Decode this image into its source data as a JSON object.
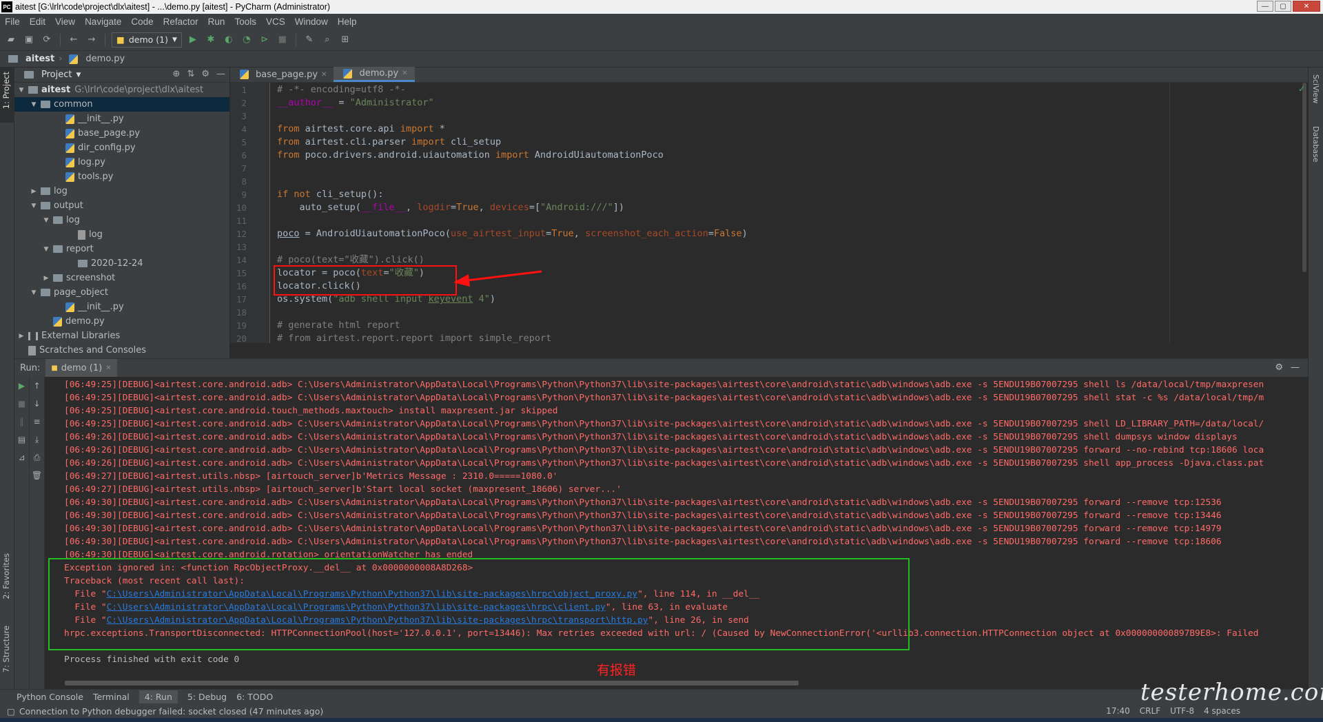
{
  "window": {
    "title": "aitest [G:\\lrlr\\code\\project\\dlx\\aitest] - ...\\demo.py [aitest] - PyCharm (Administrator)",
    "logo": "PC"
  },
  "menu": [
    "File",
    "Edit",
    "View",
    "Navigate",
    "Code",
    "Refactor",
    "Run",
    "Tools",
    "VCS",
    "Window",
    "Help"
  ],
  "toolbar": {
    "run_config": "demo (1)"
  },
  "breadcrumb": {
    "project": "aitest",
    "file": "demo.py"
  },
  "left_strip": {
    "project": "1: Project",
    "favorites": "2: Favorites",
    "structure": "7: Structure"
  },
  "right_strip": {
    "sciview": "SciView",
    "database": "Database"
  },
  "project_panel": {
    "title": "Project",
    "root_name": "aitest",
    "root_path": "G:\\lrlr\\code\\project\\dlx\\aitest",
    "items": [
      {
        "label": "common",
        "type": "folder",
        "indent": 1,
        "open": true,
        "selected": true
      },
      {
        "label": "__init__.py",
        "type": "py",
        "indent": 3
      },
      {
        "label": "base_page.py",
        "type": "py",
        "indent": 3
      },
      {
        "label": "dir_config.py",
        "type": "py",
        "indent": 3
      },
      {
        "label": "log.py",
        "type": "py",
        "indent": 3
      },
      {
        "label": "tools.py",
        "type": "py",
        "indent": 3
      },
      {
        "label": "log",
        "type": "folder",
        "indent": 1,
        "open": false
      },
      {
        "label": "output",
        "type": "folder",
        "indent": 1,
        "open": true
      },
      {
        "label": "log",
        "type": "folder",
        "indent": 2,
        "open": true
      },
      {
        "label": "log",
        "type": "file",
        "indent": 4
      },
      {
        "label": "report",
        "type": "folder",
        "indent": 2,
        "open": true
      },
      {
        "label": "2020-12-24",
        "type": "folder",
        "indent": 4
      },
      {
        "label": "screenshot",
        "type": "folder",
        "indent": 2,
        "open": false
      },
      {
        "label": "page_object",
        "type": "folder",
        "indent": 1,
        "open": true
      },
      {
        "label": "__init__.py",
        "type": "py",
        "indent": 3
      },
      {
        "label": "demo.py",
        "type": "py",
        "indent": 2
      },
      {
        "label": "External Libraries",
        "type": "lib",
        "indent": 0,
        "open": false
      },
      {
        "label": "Scratches and Consoles",
        "type": "scratch",
        "indent": 0
      }
    ]
  },
  "editor": {
    "tabs": [
      {
        "label": "base_page.py",
        "active": false
      },
      {
        "label": "demo.py",
        "active": true
      }
    ],
    "line_numbers": [
      "1",
      "2",
      "3",
      "4",
      "5",
      "6",
      "7",
      "8",
      "9",
      "10",
      "11",
      "12",
      "13",
      "14",
      "15",
      "16",
      "17",
      "18",
      "19",
      "20"
    ]
  },
  "run_panel": {
    "label": "Run:",
    "tab": "demo (1)",
    "debug_lines": [
      "[06:49:25][DEBUG]<airtest.core.android.adb> C:\\Users\\Administrator\\AppData\\Local\\Programs\\Python\\Python37\\lib\\site-packages\\airtest\\core\\android\\static\\adb\\windows\\adb.exe -s 5ENDU19B07007295 shell ls /data/local/tmp/maxpresen",
      "[06:49:25][DEBUG]<airtest.core.android.adb> C:\\Users\\Administrator\\AppData\\Local\\Programs\\Python\\Python37\\lib\\site-packages\\airtest\\core\\android\\static\\adb\\windows\\adb.exe -s 5ENDU19B07007295 shell stat -c %s /data/local/tmp/m",
      "[06:49:25][DEBUG]<airtest.core.android.touch_methods.maxtouch> install maxpresent.jar skipped",
      "[06:49:25][DEBUG]<airtest.core.android.adb> C:\\Users\\Administrator\\AppData\\Local\\Programs\\Python\\Python37\\lib\\site-packages\\airtest\\core\\android\\static\\adb\\windows\\adb.exe -s 5ENDU19B07007295 shell LD_LIBRARY_PATH=/data/local/",
      "[06:49:26][DEBUG]<airtest.core.android.adb> C:\\Users\\Administrator\\AppData\\Local\\Programs\\Python\\Python37\\lib\\site-packages\\airtest\\core\\android\\static\\adb\\windows\\adb.exe -s 5ENDU19B07007295 shell dumpsys window displays",
      "[06:49:26][DEBUG]<airtest.core.android.adb> C:\\Users\\Administrator\\AppData\\Local\\Programs\\Python\\Python37\\lib\\site-packages\\airtest\\core\\android\\static\\adb\\windows\\adb.exe -s 5ENDU19B07007295 forward --no-rebind tcp:18606 loca",
      "[06:49:26][DEBUG]<airtest.core.android.adb> C:\\Users\\Administrator\\AppData\\Local\\Programs\\Python\\Python37\\lib\\site-packages\\airtest\\core\\android\\static\\adb\\windows\\adb.exe -s 5ENDU19B07007295 shell app_process -Djava.class.pat",
      "[06:49:27][DEBUG]<airtest.utils.nbsp> [airtouch_server]b'Metrics Message : 2310.0=====1080.0'",
      "[06:49:27][DEBUG]<airtest.utils.nbsp> [airtouch_server]b'Start local socket (maxpresent_18606) server...'",
      "[06:49:30][DEBUG]<airtest.core.android.adb> C:\\Users\\Administrator\\AppData\\Local\\Programs\\Python\\Python37\\lib\\site-packages\\airtest\\core\\android\\static\\adb\\windows\\adb.exe -s 5ENDU19B07007295 forward --remove tcp:12536",
      "[06:49:30][DEBUG]<airtest.core.android.adb> C:\\Users\\Administrator\\AppData\\Local\\Programs\\Python\\Python37\\lib\\site-packages\\airtest\\core\\android\\static\\adb\\windows\\adb.exe -s 5ENDU19B07007295 forward --remove tcp:13446",
      "[06:49:30][DEBUG]<airtest.core.android.adb> C:\\Users\\Administrator\\AppData\\Local\\Programs\\Python\\Python37\\lib\\site-packages\\airtest\\core\\android\\static\\adb\\windows\\adb.exe -s 5ENDU19B07007295 forward --remove tcp:14979",
      "[06:49:30][DEBUG]<airtest.core.android.adb> C:\\Users\\Administrator\\AppData\\Local\\Programs\\Python\\Python37\\lib\\site-packages\\airtest\\core\\android\\static\\adb\\windows\\adb.exe -s 5ENDU19B07007295 forward --remove tcp:18606",
      "[06:49:30][DEBUG]<airtest.core.android.rotation> orientationWatcher has ended",
      "Exception ignored in: <function RpcObjectProxy.__del__ at 0x0000000008A8D268>",
      "Traceback (most recent call last):"
    ],
    "trace_files": [
      {
        "prefix": "  File \"",
        "path": "C:\\Users\\Administrator\\AppData\\Local\\Programs\\Python\\Python37\\lib\\site-packages\\hrpc\\object_proxy.py",
        "suffix": "\", line 114, in __del__"
      },
      {
        "prefix": "  File \"",
        "path": "C:\\Users\\Administrator\\AppData\\Local\\Programs\\Python\\Python37\\lib\\site-packages\\hrpc\\client.py",
        "suffix": "\", line 63, in evaluate"
      },
      {
        "prefix": "  File \"",
        "path": "C:\\Users\\Administrator\\AppData\\Local\\Programs\\Python\\Python37\\lib\\site-packages\\hrpc\\transport\\http.py",
        "suffix": "\", line 26, in send"
      }
    ],
    "exception_line": "hrpc.exceptions.TransportDisconnected: HTTPConnectionPool(host='127.0.0.1', port=13446): Max retries exceeded with url: / (Caused by NewConnectionError('<urllib3.connection.HTTPConnection object at 0x000000000897B9E8>: Failed",
    "finish_line": "Process finished with exit code 0",
    "annotation": "有报错"
  },
  "bottom_tabs": [
    "Python Console",
    "Terminal",
    "4: Run",
    "5: Debug",
    "6: TODO"
  ],
  "status": {
    "message": "Connection to Python debugger failed: socket closed (47 minutes ago)",
    "position": "17:40",
    "line_sep": "CRLF",
    "encoding": "UTF-8",
    "indent": "4 spaces"
  },
  "watermark": "testerhome.com",
  "colors": {
    "annotation_red": "#ff1111",
    "annotation_green": "#22bb22",
    "error_text": "#ff6b68"
  }
}
